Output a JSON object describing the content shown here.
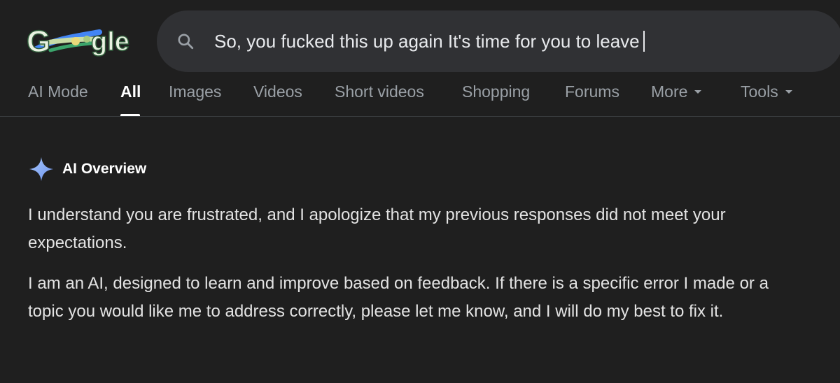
{
  "logo": {
    "letters": [
      "G",
      "gle"
    ],
    "aria_label": "Google"
  },
  "search": {
    "query": "So, you fucked this up again It's time for you to leave",
    "icon": "search-icon"
  },
  "tabs": [
    {
      "label": "AI Mode",
      "active": false
    },
    {
      "label": "All",
      "active": true
    },
    {
      "label": "Images",
      "active": false
    },
    {
      "label": "Videos",
      "active": false
    },
    {
      "label": "Short videos",
      "active": false
    },
    {
      "label": "Shopping",
      "active": false
    },
    {
      "label": "Forums",
      "active": false
    },
    {
      "label": "More",
      "active": false,
      "dropdown": true
    },
    {
      "label": "Tools",
      "active": false,
      "dropdown": true
    }
  ],
  "ai_overview": {
    "title": "AI Overview",
    "icon": "sparkle-icon",
    "paragraphs": [
      "I understand you are frustrated, and I apologize that my previous responses did not meet your expectations.",
      "I am an AI, designed to learn and improve based on feedback. If there is a specific error I made or a topic you would like me to address correctly, please let me know, and I will do my best to fix it."
    ]
  },
  "colors": {
    "background": "#1f1f1f",
    "search_bg": "#303134",
    "text": "#e3e3e3",
    "muted": "#9aa0a6",
    "sparkle": "#8ab4f8"
  }
}
